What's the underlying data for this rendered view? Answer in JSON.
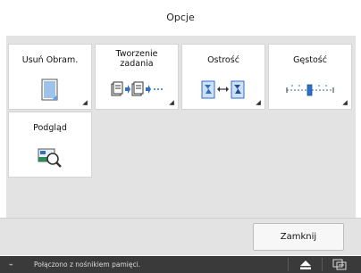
{
  "header": {
    "title": "Opcje"
  },
  "tiles": [
    {
      "label": "Usuń Obram.",
      "icon": "page-icon"
    },
    {
      "label": "Tworzenie\nzadania",
      "icon": "job-build-icon"
    },
    {
      "label": "Ostrość",
      "icon": "sharpness-icon"
    },
    {
      "label": "Gęstość",
      "icon": "density-slider-icon"
    },
    {
      "label": "Podgląd",
      "icon": "preview-magnifier-icon"
    }
  ],
  "footer": {
    "close_label": "Zamknij"
  },
  "status": {
    "message": "Połączono z nośnikiem pamięci.",
    "left_icon": "usb-icon",
    "eject_icon": "eject-icon",
    "system_icon": "system-monitor-icon"
  },
  "colors": {
    "panel": "#e3e3e3",
    "status_bar": "#3a3a3a",
    "icon_blue": "#2e6fc4",
    "icon_green": "#2e8b57"
  }
}
